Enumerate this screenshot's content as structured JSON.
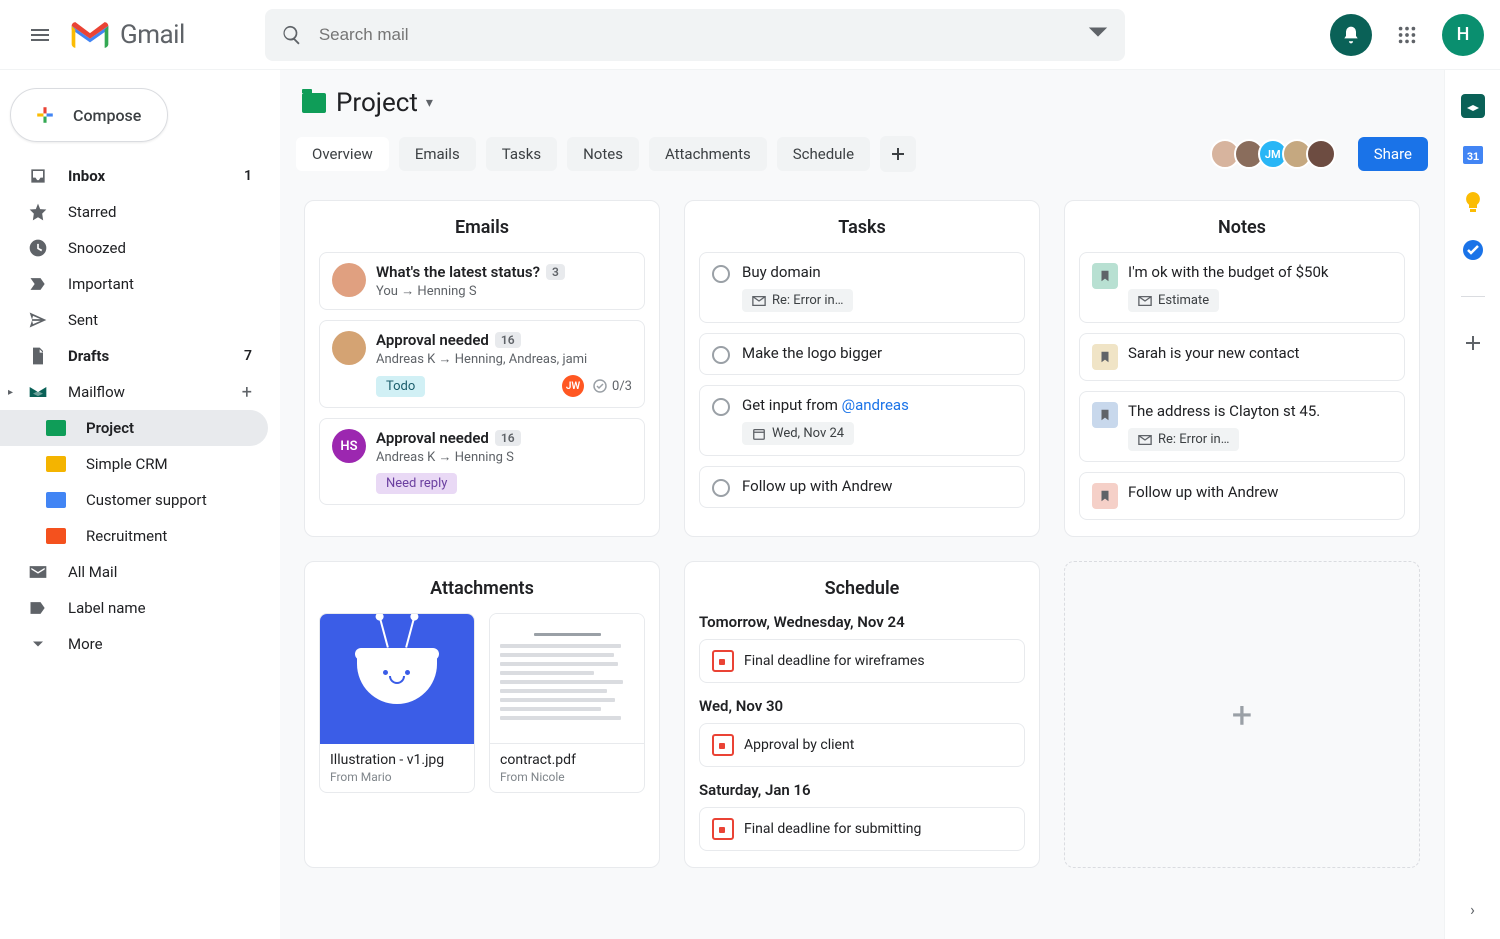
{
  "header": {
    "app_name": "Gmail",
    "search_placeholder": "Search mail",
    "avatar_initial": "H"
  },
  "compose_label": "Compose",
  "sidebar": {
    "inbox": {
      "label": "Inbox",
      "count": "1"
    },
    "starred": {
      "label": "Starred"
    },
    "snoozed": {
      "label": "Snoozed"
    },
    "important": {
      "label": "Important"
    },
    "sent": {
      "label": "Sent"
    },
    "drafts": {
      "label": "Drafts",
      "count": "7"
    },
    "mailflow": {
      "label": "Mailflow"
    },
    "project": {
      "label": "Project"
    },
    "crm": {
      "label": "Simple CRM"
    },
    "support": {
      "label": "Customer support"
    },
    "recruitment": {
      "label": "Recruitment"
    },
    "allmail": {
      "label": "All Mail"
    },
    "labelname": {
      "label": "Label name"
    },
    "more": {
      "label": "More"
    }
  },
  "page": {
    "title": "Project",
    "tabs": [
      "Overview",
      "Emails",
      "Tasks",
      "Notes",
      "Attachments",
      "Schedule"
    ],
    "share_label": "Share"
  },
  "cards": {
    "emails": {
      "title": "Emails",
      "items": [
        {
          "subject": "What's the latest status?",
          "badge": "3",
          "meta": "You → Henning S"
        },
        {
          "subject": "Approval needed",
          "badge": "16",
          "meta": "Andreas K → Henning, Andreas, jami",
          "chip": "Todo",
          "mini": "JW",
          "count": "0/3"
        },
        {
          "subject": "Approval needed",
          "badge": "16",
          "meta": "Andreas K → Henning S",
          "chip": "Need reply",
          "mini_initials": "HS"
        }
      ]
    },
    "tasks": {
      "title": "Tasks",
      "items": [
        {
          "title": "Buy domain",
          "pill": "Re: Error in…",
          "pill_icon": "mail"
        },
        {
          "title": "Make the logo bigger"
        },
        {
          "title_prefix": "Get input from ",
          "mention": "@andreas",
          "pill": "Wed, Nov 24",
          "pill_icon": "cal"
        },
        {
          "title": "Follow up with Andrew"
        }
      ]
    },
    "notes": {
      "title": "Notes",
      "items": [
        {
          "title": "I'm ok with the budget of $50k",
          "pill": "Estimate",
          "color": "#b8e0d2"
        },
        {
          "title": "Sarah is your new contact",
          "color": "#f0e4c6"
        },
        {
          "title": "The address is Clayton st 45.",
          "pill": "Re: Error in…",
          "color": "#c8d8ec"
        },
        {
          "title": "Follow up with Andrew",
          "color": "#f5d0c8"
        }
      ]
    },
    "attachments": {
      "title": "Attachments",
      "items": [
        {
          "name": "Illustration - v1.jpg",
          "from": "From Mario"
        },
        {
          "name": "contract.pdf",
          "from": "From Nicole"
        }
      ]
    },
    "schedule": {
      "title": "Schedule",
      "sections": [
        {
          "date": "Tomorrow, Wednesday, Nov 24",
          "event": "Final deadline for wireframes"
        },
        {
          "date": "Wed, Nov 30",
          "event": "Approval by client"
        },
        {
          "date": "Saturday, Jan 16",
          "event": "Final deadline for submitting"
        }
      ]
    }
  },
  "colors": {
    "folder_green": "#0f9d58",
    "folder_yellow": "#f4b400",
    "folder_blue": "#4285f4",
    "folder_orange": "#f4511e",
    "accent": "#1a73e8"
  }
}
